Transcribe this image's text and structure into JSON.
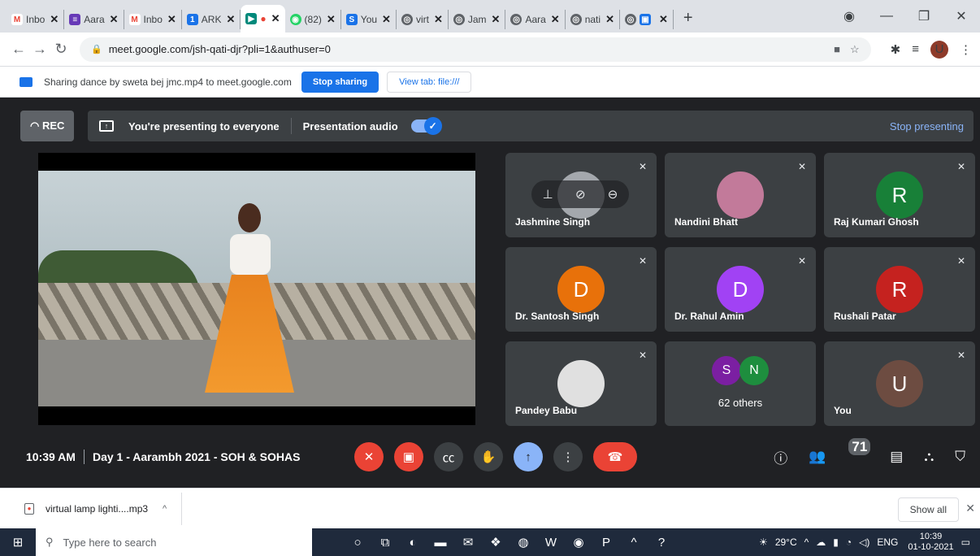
{
  "browser": {
    "tabs": [
      {
        "title": "Inbo",
        "fav": "M",
        "color": "#ea4335"
      },
      {
        "title": "Aara",
        "fav": "≡",
        "color": "#673ab7"
      },
      {
        "title": "Inbo",
        "fav": "M",
        "color": "#ea4335"
      },
      {
        "title": "ARK",
        "fav": "1",
        "color": "#1a73e8"
      },
      {
        "title": "",
        "fav": "●",
        "color": "#f4b400",
        "active": true
      },
      {
        "title": "(82)",
        "fav": "◉",
        "color": "#25d366"
      },
      {
        "title": "You",
        "fav": "S",
        "color": "#1a73e8"
      },
      {
        "title": "virt",
        "fav": "◎",
        "color": "#5f6368"
      },
      {
        "title": "Jam",
        "fav": "◎",
        "color": "#5f6368"
      },
      {
        "title": "Aara",
        "fav": "◎",
        "color": "#5f6368"
      },
      {
        "title": "nati",
        "fav": "◎",
        "color": "#5f6368"
      },
      {
        "title": "",
        "fav": "▣",
        "color": "#1a73e8"
      }
    ],
    "url": "meet.google.com/jsh-qati-djr?pli=1&authuser=0",
    "profile_initial": "U"
  },
  "sharebar": {
    "text": "Sharing dance by sweta bej jmc.mp4 to meet.google.com",
    "stop_label": "Stop sharing",
    "view_label": "View tab: file:///"
  },
  "meet": {
    "rec_label": "REC",
    "presenting_text": "You're presenting to everyone",
    "audio_label": "Presentation audio",
    "stop_presenting": "Stop presenting",
    "tiles": [
      {
        "name": "Jashmine Singh"
      },
      {
        "name": "Nandini Bhatt"
      },
      {
        "name": "Raj Kumari Ghosh",
        "initial": "R"
      },
      {
        "name": "Dr. Santosh Singh",
        "initial": "D"
      },
      {
        "name": "Dr. Rahul Amin",
        "initial": "D"
      },
      {
        "name": "Rushali Patar",
        "initial": "R"
      },
      {
        "name": "Pandey Babu"
      },
      {
        "others_label": "62 others",
        "i1": "S",
        "i2": "N"
      },
      {
        "name": "You",
        "initial": "U"
      }
    ],
    "time": "10:39 AM",
    "meeting_title": "Day 1 - Aarambh 2021 - SOH & SOHAS",
    "participants_count": "71"
  },
  "shelf": {
    "filename": "virtual lamp lighti....mp3",
    "show_all": "Show all"
  },
  "taskbar": {
    "search_placeholder": "Type here to search",
    "temperature": "29°C",
    "lang": "ENG",
    "time": "10:39",
    "date": "01-10-2021"
  }
}
